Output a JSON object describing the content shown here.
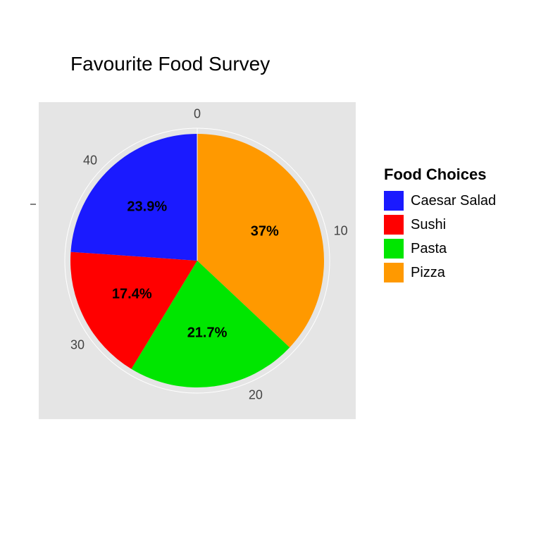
{
  "chart_data": {
    "type": "pie",
    "title": "Favourite Food Survey",
    "legend_title": "Food Choices",
    "slices": [
      {
        "name": "Pizza",
        "percent": 37.0,
        "label": "37%",
        "color": "#ff9900"
      },
      {
        "name": "Pasta",
        "percent": 21.7,
        "label": "21.7%",
        "color": "#00e600"
      },
      {
        "name": "Sushi",
        "percent": 17.4,
        "label": "17.4%",
        "color": "#ff0000"
      },
      {
        "name": "Caesar Salad",
        "percent": 23.9,
        "label": "23.9%",
        "color": "#1a1aff"
      }
    ],
    "legend_order": [
      "Caesar Salad",
      "Sushi",
      "Pasta",
      "Pizza"
    ],
    "ticks": [
      {
        "value": 0,
        "label": "0"
      },
      {
        "value": 10,
        "label": "10"
      },
      {
        "value": 20,
        "label": "20"
      },
      {
        "value": 30,
        "label": "30"
      },
      {
        "value": 40,
        "label": "40"
      }
    ],
    "cumulative_max": 46
  }
}
